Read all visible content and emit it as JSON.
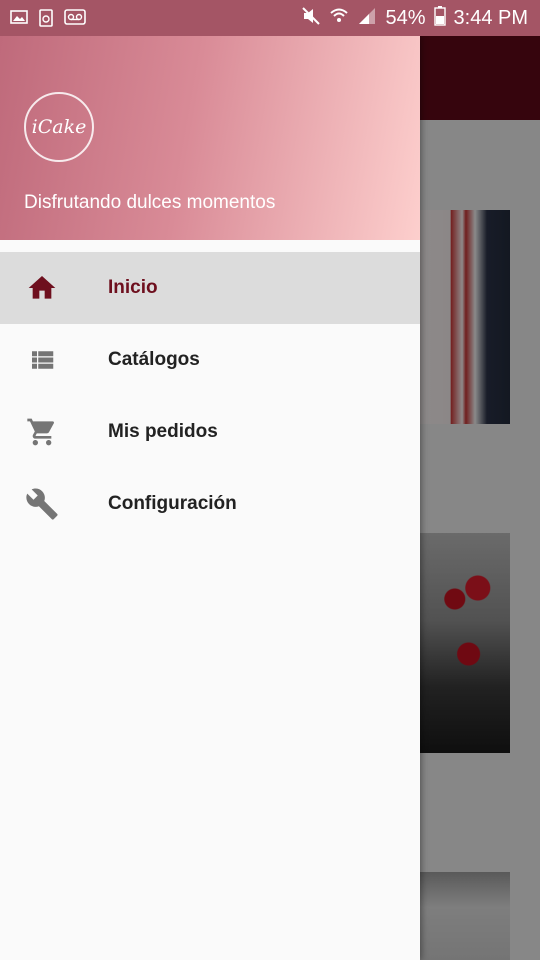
{
  "status_bar": {
    "battery_percent": "54%",
    "time": "3:44 PM",
    "icons": [
      "gallery-icon",
      "recycle-icon",
      "voicemail-icon",
      "mute-icon",
      "wifi-icon",
      "signal-icon",
      "battery-icon"
    ]
  },
  "drawer": {
    "logo_text": "iCake",
    "tagline": "Disfrutando dulces momentos",
    "items": [
      {
        "label": "Inicio",
        "icon": "home-icon",
        "active": true
      },
      {
        "label": "Catálogos",
        "icon": "list-icon",
        "active": false
      },
      {
        "label": "Mis pedidos",
        "icon": "cart-icon",
        "active": false
      },
      {
        "label": "Configuración",
        "icon": "wrench-icon",
        "active": false
      }
    ]
  },
  "colors": {
    "status_bar": "#a45565",
    "toolbar": "#5e0a18",
    "active_item_bg": "#dcdcdc",
    "active_label": "#6e0f1e",
    "header_gradient_start": "#bf6a7b",
    "header_gradient_end": "#fdcfcd"
  }
}
